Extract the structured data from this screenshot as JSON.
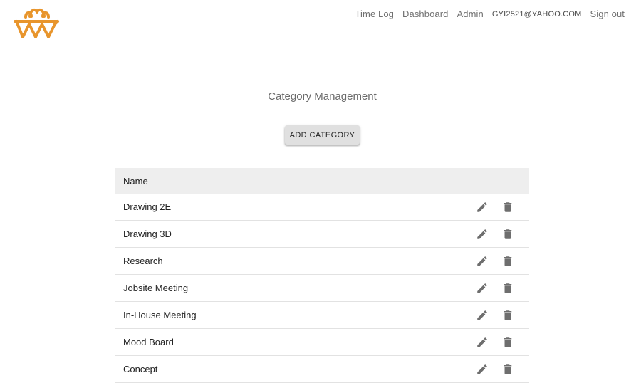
{
  "brand": {
    "logo_icon": "ww-logo-icon",
    "color": "#e8952c"
  },
  "nav": {
    "items": [
      "Time Log",
      "Dashboard",
      "Admin"
    ],
    "user": "GYI2521@YAHOO.COM",
    "sign_out": "Sign out"
  },
  "page": {
    "title": "Category Management",
    "add_button": "ADD CATEGORY"
  },
  "table": {
    "header": "Name",
    "row_actions": [
      "edit-icon",
      "delete-icon"
    ],
    "rows": [
      "Drawing 2E",
      "Drawing 3D",
      "Research",
      "Jobsite Meeting",
      "In-House Meeting",
      "Mood Board",
      "Concept"
    ]
  }
}
